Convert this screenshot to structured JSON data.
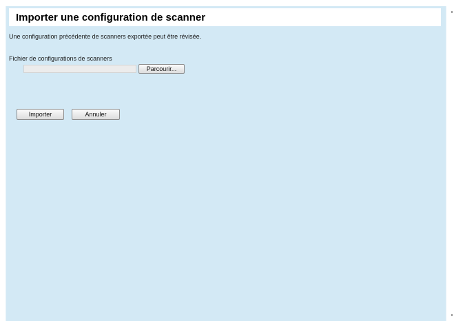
{
  "page": {
    "title": "Importer une configuration de scanner",
    "description": "Une configuration précédente de scanners exportée peut être révisée."
  },
  "form": {
    "file_label": "Fichier de configurations de scanners",
    "file_value": "",
    "browse_label": "Parcourir...",
    "import_label": "Importer",
    "cancel_label": "Annuler"
  },
  "colors": {
    "panel_background": "#d3e9f5",
    "title_background": "#ffffff"
  }
}
